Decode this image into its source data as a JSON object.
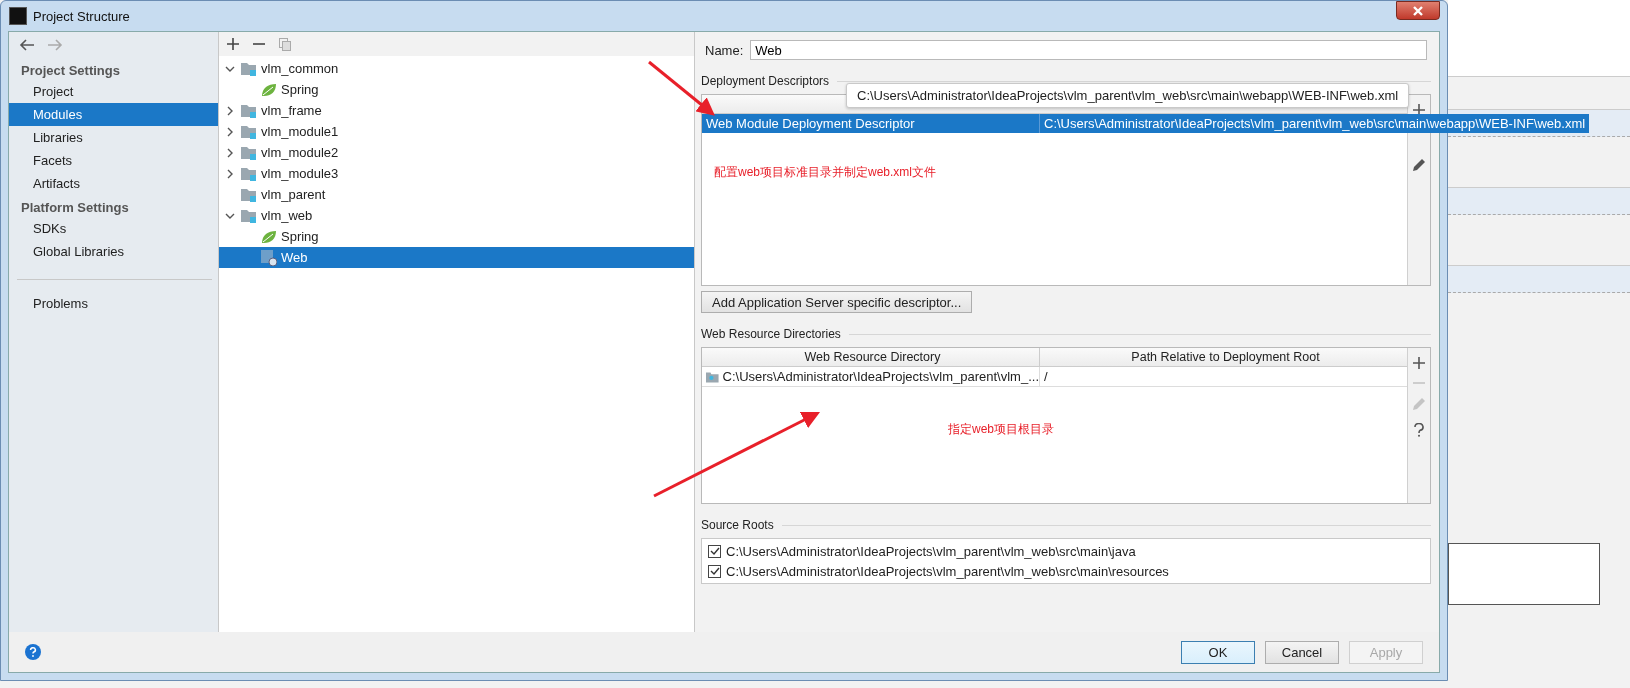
{
  "window": {
    "title": "Project Structure"
  },
  "sidebar": {
    "sections": [
      {
        "heading": "Project Settings",
        "items": [
          {
            "label": "Project",
            "selected": false
          },
          {
            "label": "Modules",
            "selected": true
          },
          {
            "label": "Libraries",
            "selected": false
          },
          {
            "label": "Facets",
            "selected": false
          },
          {
            "label": "Artifacts",
            "selected": false
          }
        ]
      },
      {
        "heading": "Platform Settings",
        "items": [
          {
            "label": "SDKs",
            "selected": false
          },
          {
            "label": "Global Libraries",
            "selected": false
          }
        ]
      }
    ],
    "problems": {
      "label": "Problems",
      "selected": false
    }
  },
  "tree": [
    {
      "label": "vlm_common",
      "kind": "module",
      "expanded": true,
      "selected": false,
      "children": [
        {
          "label": "Spring",
          "kind": "spring",
          "selected": false
        }
      ]
    },
    {
      "label": "vlm_frame",
      "kind": "module",
      "expanded": false,
      "selected": false
    },
    {
      "label": "vlm_module1",
      "kind": "module",
      "expanded": false,
      "selected": false
    },
    {
      "label": "vlm_module2",
      "kind": "module",
      "expanded": false,
      "selected": false
    },
    {
      "label": "vlm_module3",
      "kind": "module",
      "expanded": false,
      "selected": false
    },
    {
      "label": "vlm_parent",
      "kind": "module",
      "selected": false
    },
    {
      "label": "vlm_web",
      "kind": "module",
      "expanded": true,
      "selected": false,
      "children": [
        {
          "label": "Spring",
          "kind": "spring",
          "selected": false
        },
        {
          "label": "Web",
          "kind": "web",
          "selected": true
        }
      ]
    }
  ],
  "detail": {
    "name_label": "Name:",
    "name_value": "Web",
    "deployment": {
      "title": "Deployment Descriptors",
      "rows": [
        {
          "descriptor": "Web Module Deployment Descriptor",
          "path": "C:\\Users\\Administrator\\IdeaProjects\\vlm_parent\\vlm_web\\src\\main\\webapp\\WEB-INF\\web.xml",
          "selected": true
        }
      ],
      "tooltip": "C:\\Users\\Administrator\\IdeaProjects\\vlm_parent\\vlm_web\\src\\main\\webapp\\WEB-INF\\web.xml",
      "note": "配置web项目标准目录并制定web.xml文件",
      "add_button": "Add Application Server specific descriptor..."
    },
    "resources": {
      "title": "Web Resource Directories",
      "columns": [
        "Web Resource Directory",
        "Path Relative to Deployment Root"
      ],
      "rows": [
        {
          "directory": "C:\\Users\\Administrator\\IdeaProjects\\vlm_parent\\vlm_...",
          "path": "/",
          "selected": false
        }
      ],
      "tools": [
        {
          "kind": "plus",
          "disabled": false
        },
        {
          "kind": "minus",
          "disabled": true
        },
        {
          "kind": "edit",
          "disabled": true
        },
        {
          "kind": "help",
          "disabled": false
        }
      ],
      "note": "指定web项目根目录"
    },
    "sources": {
      "title": "Source Roots",
      "items": [
        {
          "path": "C:\\Users\\Administrator\\IdeaProjects\\vlm_parent\\vlm_web\\src\\main\\java",
          "checked": true
        },
        {
          "path": "C:\\Users\\Administrator\\IdeaProjects\\vlm_parent\\vlm_web\\src\\main\\resources",
          "checked": true
        }
      ]
    }
  },
  "footer": {
    "buttons": [
      {
        "label": "OK",
        "kind": "primary",
        "disabled": false
      },
      {
        "label": "Cancel",
        "kind": "normal",
        "disabled": false
      },
      {
        "label": "Apply",
        "kind": "normal",
        "disabled": true
      }
    ]
  }
}
